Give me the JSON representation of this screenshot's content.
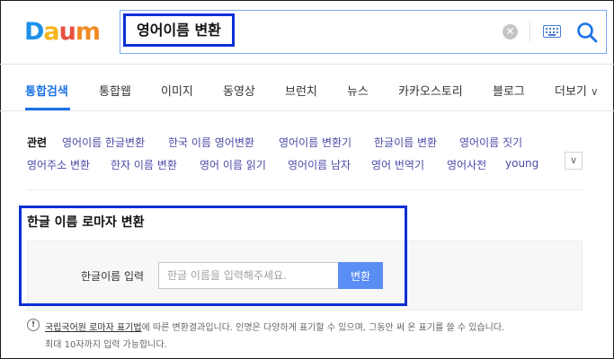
{
  "logo": {
    "letters": [
      "D",
      "a",
      "u",
      "m"
    ],
    "colors": [
      "#1e90e8",
      "#f5b61b",
      "#e8503c",
      "#f08a24"
    ]
  },
  "search": {
    "query": "영어이름 변환",
    "clear_icon": "clear-circle-icon",
    "keyboard_icon": "keyboard-icon",
    "search_icon": "magnifier-icon",
    "accent_color": "#1a73e8"
  },
  "tabs": [
    {
      "label": "통합검색",
      "active": true
    },
    {
      "label": "통합웹"
    },
    {
      "label": "이미지"
    },
    {
      "label": "동영상"
    },
    {
      "label": "브런치"
    },
    {
      "label": "뉴스"
    },
    {
      "label": "카카오스토리"
    },
    {
      "label": "블로그"
    },
    {
      "label": "더보기"
    }
  ],
  "related": {
    "title": "관련",
    "links": [
      "영어이름 한글변환",
      "한국 이름 영어변환",
      "영어이름 변환기",
      "한글이름 변환",
      "영어이름 짓기",
      "영어주소 변환",
      "한자 이름 변환",
      "영어 이름 읽기",
      "영어이름 남자",
      "영어 번역기",
      "영어사전",
      "young"
    ],
    "more_icon": "chevron-down-icon"
  },
  "converter": {
    "title": "한글 이름 로마자 변환",
    "input_label": "한글이름 입력",
    "placeholder": "한글 이름을 입력해주세요.",
    "button": "변환"
  },
  "notice": {
    "icon": "exclamation-icon",
    "link": "국립국어원 로마자 표기법",
    "line1_rest": "에 따른 변환결과입니다. 인명은 다양하게 표기할 수 있으며, 그동안 써 온 표기를 쓸 수 있습니다.",
    "line2": "최대 10자까지 입력 가능합니다."
  }
}
